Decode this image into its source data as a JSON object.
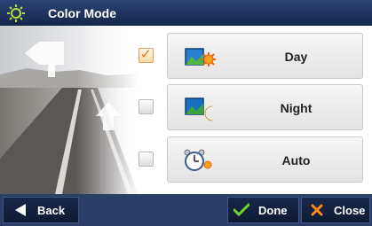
{
  "title": "Color Mode",
  "options": [
    {
      "label": "Day",
      "checked": true,
      "icon": "day-icon"
    },
    {
      "label": "Night",
      "checked": false,
      "icon": "night-icon"
    },
    {
      "label": "Auto",
      "checked": false,
      "icon": "auto-clock-icon"
    }
  ],
  "footer": {
    "back_label": "Back",
    "done_label": "Done",
    "close_label": "Close"
  },
  "colors": {
    "title_bar": "#1e3560",
    "footer_bar": "#2a3e66",
    "check_accent": "#e07a1e",
    "done_check": "#6fd12a",
    "close_x": "#ff8a1c"
  }
}
